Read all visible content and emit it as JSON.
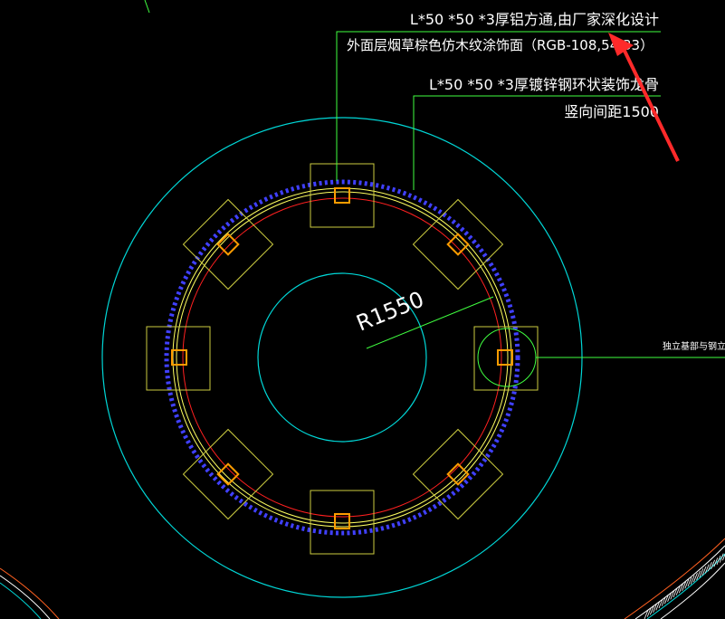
{
  "annotations": {
    "line1": "L*50 *50 *3厚铝方通,由厂家深化设计",
    "line2": "外面层烟草棕色仿木纹涂饰面（RGB-108,5",
    "line2_hidden": "4,33）",
    "line3": "L*50 *50 *3厚镀锌钢环状装饰龙骨",
    "line4": "竖向间距1500",
    "side_label": "独立基部与钢立"
  },
  "radius_label": "R1550",
  "colors": {
    "background": "#000000",
    "outer_circle": "#00d7d7",
    "inner_circle": "#00d7d7",
    "ring_yellow": "#ffff60",
    "ring_red": "#ff2020",
    "dashes": "#4040ff",
    "frames": "#cccc40",
    "posts": "#ff9c00",
    "leaders": "#40ff40",
    "arrow": "#ff2a2a",
    "text": "#ffffff"
  }
}
